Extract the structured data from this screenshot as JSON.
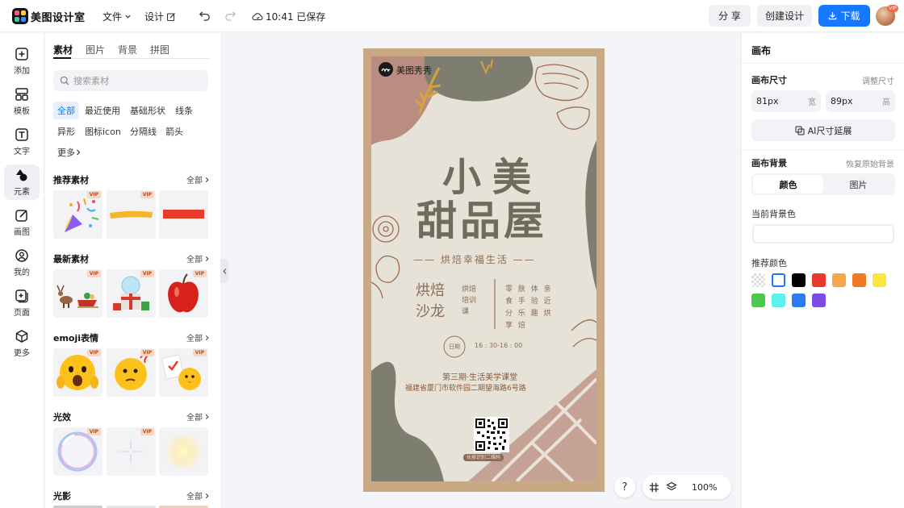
{
  "app": {
    "name": "美图设计室"
  },
  "toolbar": {
    "file_label": "文件",
    "design_label": "设计",
    "save_status": "10:41 已保存",
    "share_label": "分 享",
    "create_label": "创建设计",
    "download_label": "下载",
    "vip_badge": "VIP"
  },
  "rail": {
    "items": [
      {
        "label": "添加",
        "icon": "plus-square-icon"
      },
      {
        "label": "模板",
        "icon": "template-icon"
      },
      {
        "label": "文字",
        "icon": "text-icon"
      },
      {
        "label": "元素",
        "icon": "shapes-icon"
      },
      {
        "label": "画图",
        "icon": "draw-icon"
      },
      {
        "label": "我的",
        "icon": "user-icon"
      },
      {
        "label": "页面",
        "icon": "page-add-icon"
      },
      {
        "label": "更多",
        "icon": "cube-icon"
      }
    ],
    "active_index": 3
  },
  "panel": {
    "tabs": [
      "素材",
      "图片",
      "背景",
      "拼图"
    ],
    "search_placeholder": "搜索素材",
    "chips": [
      "全部",
      "最近使用",
      "基础形状",
      "线条",
      "异形",
      "图标icon",
      "分隔线",
      "箭头"
    ],
    "more_label": "更多",
    "all_label": "全部",
    "vip_label": "VIP",
    "sections": [
      {
        "title": "推荐素材",
        "thumbs": [
          {
            "vip": true
          },
          {
            "vip": true
          },
          {
            "vip": false
          }
        ]
      },
      {
        "title": "最新素材",
        "thumbs": [
          {
            "vip": true
          },
          {
            "vip": true
          },
          {
            "vip": true
          }
        ]
      },
      {
        "title": "emoji表情",
        "thumbs": [
          {
            "vip": true
          },
          {
            "vip": true
          },
          {
            "vip": true
          }
        ]
      },
      {
        "title": "光效",
        "thumbs": [
          {
            "vip": true
          },
          {
            "vip": true
          },
          {
            "vip": false
          }
        ]
      },
      {
        "title": "光影",
        "thumbs": []
      }
    ]
  },
  "poster": {
    "brand": "美图秀秀",
    "title_line1": "小美",
    "title_line2": "甜品屋",
    "subtitle": "—— 烘焙幸福生活 ——",
    "left_block": "烘焙\n沙龙",
    "left_small": "烘焙\n培训\n课",
    "right_block": [
      "零 肤 体 亲",
      "食 手 验 近",
      "分 乐 趣 烘",
      "享   焙"
    ],
    "date_box": "日期",
    "time_text": "16 : 30-16 : 00",
    "event_line1": "第三期·生活美学课堂",
    "event_line2": "福建省厦门市软件园二期望海路6号路",
    "qr_label": "长按识别二维码"
  },
  "zoom": {
    "help": "?",
    "value": "100%"
  },
  "right": {
    "title": "画布",
    "size_label": "画布尺寸",
    "adjust_label": "调整尺寸",
    "width_value": "81px",
    "width_unit": "宽",
    "height_value": "89px",
    "height_unit": "高",
    "ai_label": "AI尺寸延展",
    "bg_label": "画布背景",
    "restore_label": "恢复原始背景",
    "seg_color": "颜色",
    "seg_image": "图片",
    "current_bg_label": "当前背景色",
    "recommend_label": "推荐颜色",
    "colors": [
      "transparent",
      "#ffffff",
      "#000000",
      "#e8392a",
      "#f4a84a",
      "#f07a24",
      "#f7e73e",
      "#4cc84a",
      "#5ff0ee",
      "#2c7bf2",
      "#7b4be6"
    ]
  }
}
